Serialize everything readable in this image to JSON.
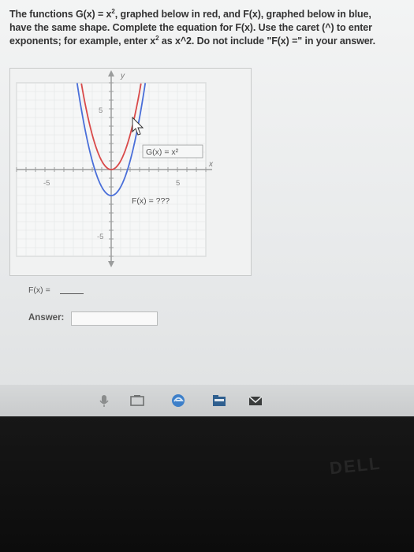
{
  "question": {
    "line1_before_sup": "The functions G(x) = x",
    "line1_sup": "2",
    "line1_after_sup": ", graphed below in red, and F(x), graphed below in blue,",
    "line2": "have the same shape. Complete the equation for F(x). Use the caret (^) to enter",
    "line3_before_sup": "exponents; for example, enter x",
    "line3_sup": "2",
    "line3_after_sup": " as x^2. Do not include \"F(x) =\" in your answer."
  },
  "graph": {
    "x_axis_label": "x",
    "y_axis_label": "y",
    "tick_x_neg": "-5",
    "tick_x_pos": "5",
    "tick_y_pos": "5",
    "tick_y_neg": "-5",
    "g_label": "G(x) = x²",
    "f_label": "F(x) = ???",
    "g_color": "#d94a4a",
    "f_color": "#4a6fd9"
  },
  "form": {
    "fx_label": "F(x) =",
    "answer_label": "Answer:",
    "answer_value": ""
  },
  "taskbar": {
    "icons": [
      "microphone-icon",
      "task-view-icon",
      "edge-icon",
      "file-explorer-icon",
      "mail-icon"
    ]
  },
  "brand": "DELL"
}
